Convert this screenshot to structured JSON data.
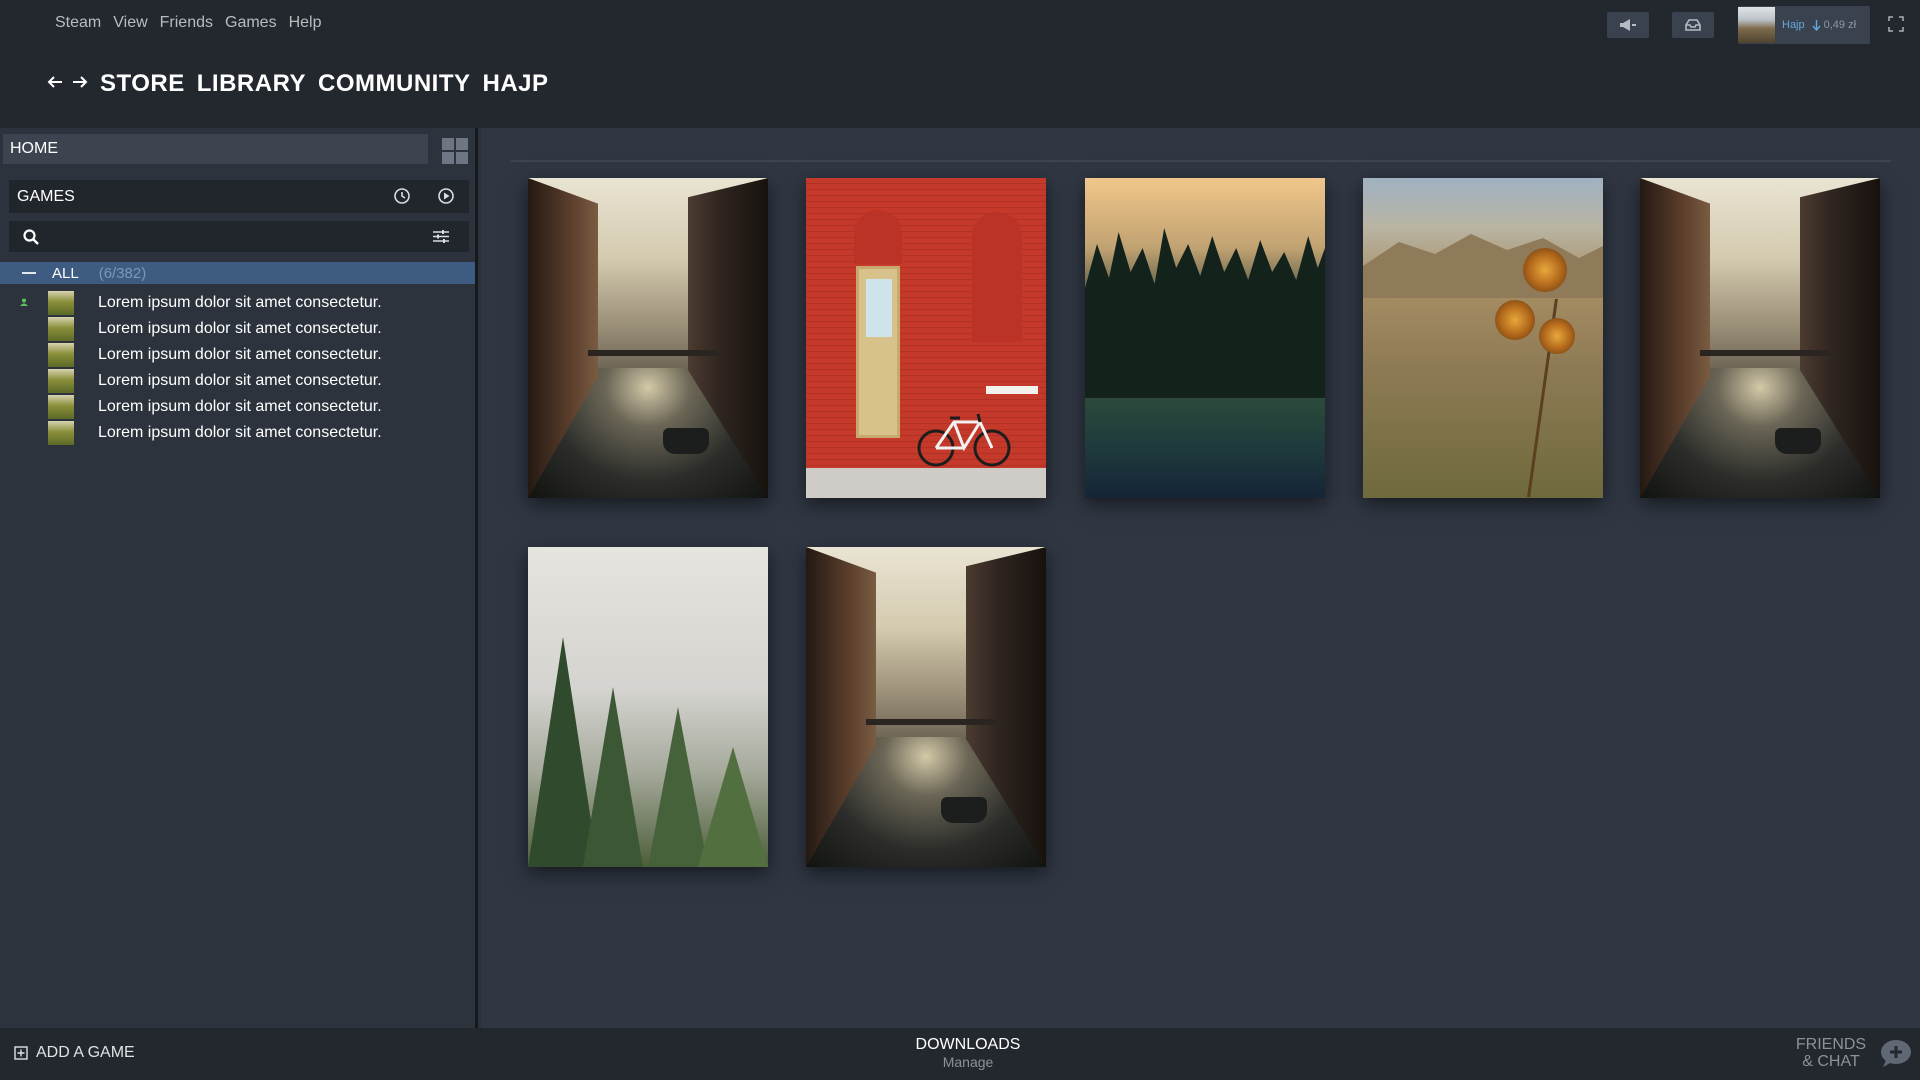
{
  "menu": [
    "Steam",
    "View",
    "Friends",
    "Games",
    "Help"
  ],
  "account": {
    "name": "Hajp",
    "balance": "0,49 zł"
  },
  "nav": [
    "STORE",
    "LIBRARY",
    "COMMUNITY",
    "HAJP"
  ],
  "sidebar": {
    "home_label": "HOME",
    "games_label": "GAMES",
    "search_placeholder": "",
    "all_label": "ALL",
    "all_count": "(6/382)",
    "games": [
      "Lorem ipsum dolor sit amet consectetur.",
      "Lorem ipsum dolor sit amet consectetur.",
      "Lorem ipsum dolor sit amet consectetur.",
      "Lorem ipsum dolor sit amet consectetur.",
      "Lorem ipsum dolor sit amet consectetur.",
      "Lorem ipsum dolor sit amet consectetur."
    ]
  },
  "tiles": [
    "canal-image",
    "red-wall-bicycle-image",
    "forest-sunset-image",
    "desert-flower-image",
    "canal-image",
    "foggy-forest-image",
    "canal-image"
  ],
  "bottom": {
    "add_game": "ADD A GAME",
    "downloads": "DOWNLOADS",
    "downloads_sub": "Manage",
    "friends_line1": "FRIENDS",
    "friends_line2": "& CHAT"
  },
  "colors": {
    "accent": "#3e5c82",
    "background": "#2c313a",
    "bar": "#23272e",
    "link": "#66a8d9"
  }
}
